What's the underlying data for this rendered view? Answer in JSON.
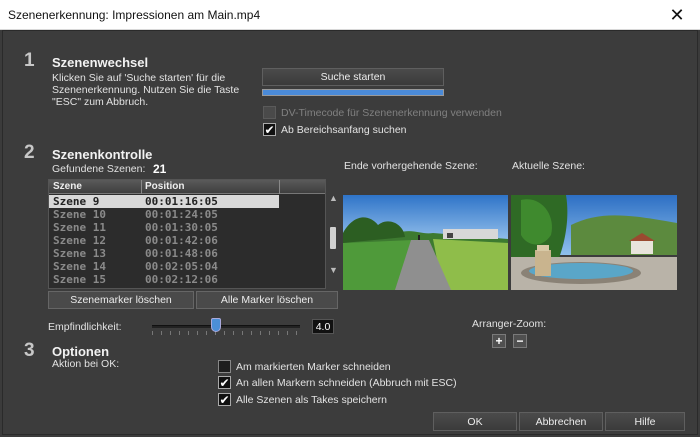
{
  "window": {
    "title": "Szenenerkennung: Impressionen am Main.mp4",
    "close_glyph": "✕"
  },
  "section1": {
    "number": "1",
    "title": "Szenenwechsel",
    "hint": "Klicken Sie auf 'Suche starten' für die Szenenerkennung. Nutzen Sie die Taste \"ESC\" zum Abbruch.",
    "search_button": "Suche starten",
    "progress_fraction": 1.0,
    "dv_timecode_label": "DV-Timecode für Szenenerkennung verwenden",
    "dv_timecode_checked": false,
    "range_start_label": "Ab Bereichsanfang suchen",
    "range_start_checked": true
  },
  "section2": {
    "number": "2",
    "title": "Szenenkontrolle",
    "found_label": "Gefundene Szenen:",
    "found_count": "21",
    "columns": {
      "scene": "Szene",
      "position": "Position"
    },
    "rows": [
      {
        "name": "Szene 9",
        "position": "00:01:16:05",
        "selected": true
      },
      {
        "name": "Szene 10",
        "position": "00:01:24:05",
        "selected": false
      },
      {
        "name": "Szene 11",
        "position": "00:01:30:05",
        "selected": false
      },
      {
        "name": "Szene 12",
        "position": "00:01:42:06",
        "selected": false
      },
      {
        "name": "Szene 13",
        "position": "00:01:48:06",
        "selected": false
      },
      {
        "name": "Szene 14",
        "position": "00:02:05:04",
        "selected": false
      },
      {
        "name": "Szene 15",
        "position": "00:02:12:06",
        "selected": false
      }
    ],
    "delete_marker_button": "Szenemarker löschen",
    "delete_all_button": "Alle Marker löschen",
    "prev_scene_label": "Ende vorhergehende Szene:",
    "current_scene_label": "Aktuelle Szene:",
    "sensitivity_label": "Empfindlichkeit:",
    "sensitivity_value": "4.0",
    "arranger_zoom_label": "Arranger-Zoom:",
    "zoom_in": "+",
    "zoom_out": "−"
  },
  "section3": {
    "number": "3",
    "title": "Optionen",
    "action_label": "Aktion bei OK:",
    "options": [
      {
        "label": "Am markierten Marker schneiden",
        "checked": false
      },
      {
        "label": "An allen Markern schneiden (Abbruch mit ESC)",
        "checked": true
      },
      {
        "label": "Alle Szenen als Takes speichern",
        "checked": true
      }
    ]
  },
  "footer": {
    "ok": "OK",
    "cancel": "Abbrechen",
    "help": "Hilfe"
  },
  "colors": {
    "accent": "#4a8ad8",
    "background": "#3b3b3b",
    "selected_row": "#d8d8d8"
  }
}
